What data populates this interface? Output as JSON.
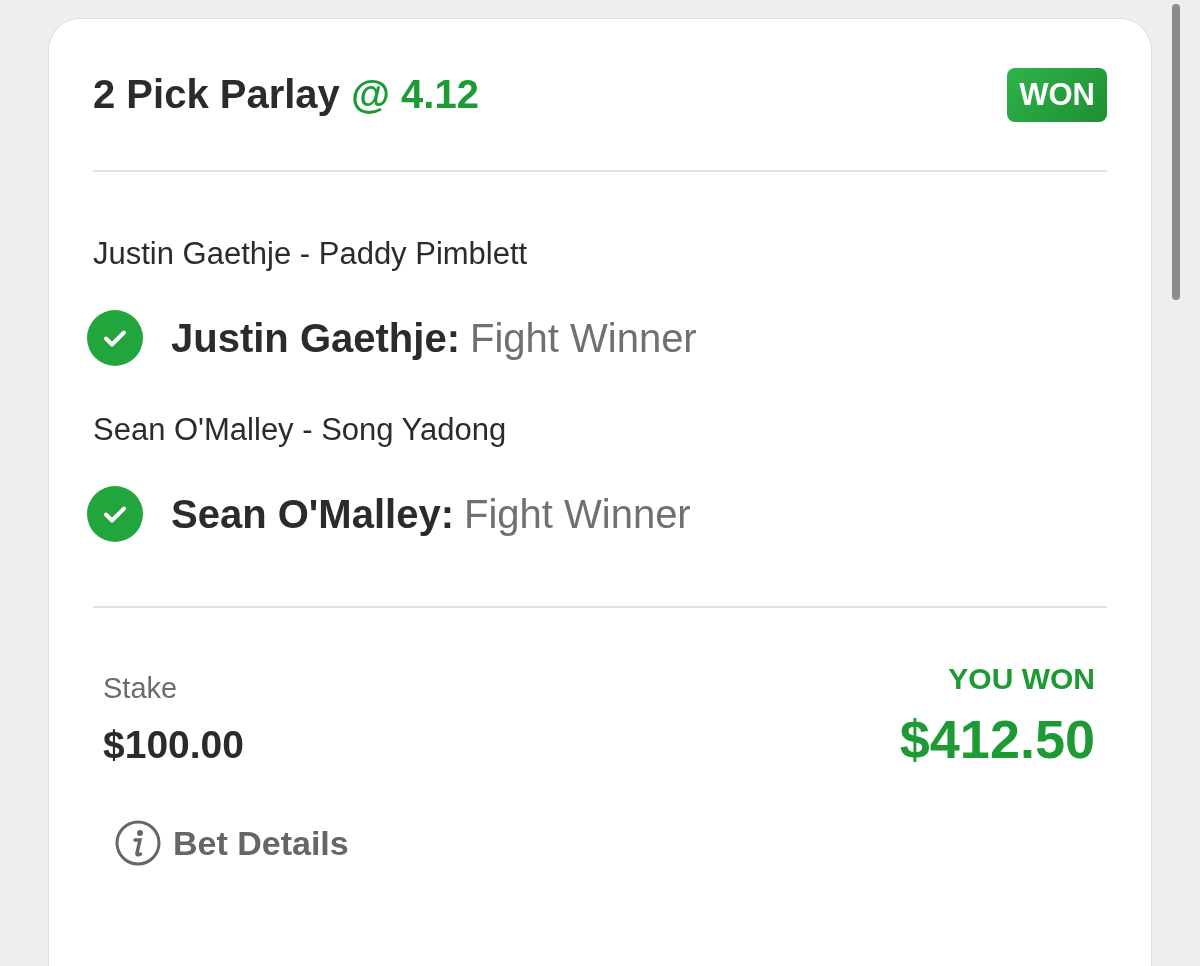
{
  "bet": {
    "title": "2 Pick Parlay",
    "odds": "@ 4.12",
    "status": "WON"
  },
  "legs": [
    {
      "event": "Justin Gaethje - Paddy Pimblett",
      "selection": "Justin Gaethje:",
      "market": "Fight Winner",
      "won": true
    },
    {
      "event": "Sean O'Malley - Song Yadong",
      "selection": "Sean O'Malley:",
      "market": "Fight Winner",
      "won": true
    }
  ],
  "stake": {
    "label": "Stake",
    "amount": "$100.00"
  },
  "payout": {
    "label": "YOU WON",
    "amount": "$412.50"
  },
  "details_link": "Bet Details"
}
